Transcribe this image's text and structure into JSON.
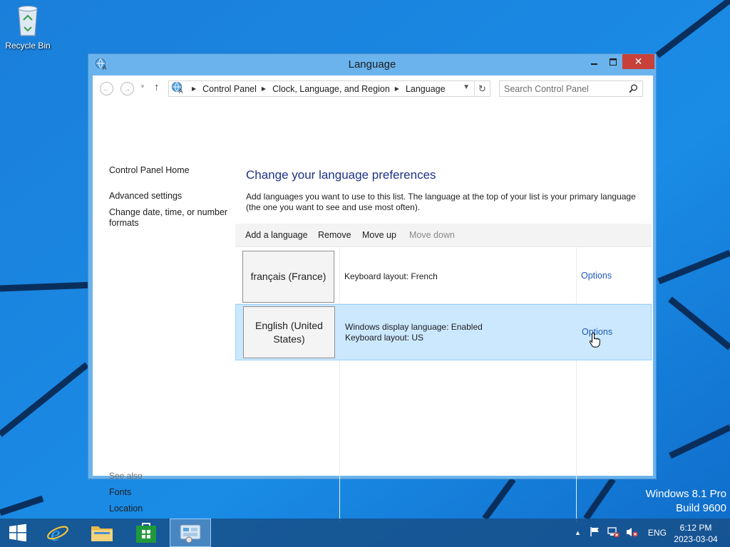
{
  "desktop": {
    "recycle_bin_label": "Recycle Bin",
    "watermark_line1": "Windows 8.1 Pro",
    "watermark_line2": "Build 9600"
  },
  "window": {
    "title": "Language",
    "close_glyph": "✕"
  },
  "address_bar": {
    "breadcrumbs": [
      "Control Panel",
      "Clock, Language, and Region",
      "Language"
    ],
    "search_placeholder": "Search Control Panel"
  },
  "left_pane": {
    "links": [
      "Control Panel Home",
      "Advanced settings",
      "Change date, time, or number formats"
    ],
    "see_also_heading": "See also",
    "see_also_links": [
      "Fonts",
      "Location"
    ]
  },
  "main": {
    "title": "Change your language preferences",
    "description": "Add languages you want to use to this list. The language at the top of your list is your primary language (the one you want to see and use most often).",
    "toolbar": {
      "add": "Add a language",
      "remove": "Remove",
      "move_up": "Move up",
      "move_down": "Move down"
    },
    "languages": [
      {
        "name": "français (France)",
        "info_line1": "Keyboard layout: French",
        "info_line2": "",
        "options": "Options",
        "selected": false
      },
      {
        "name": "English (United States)",
        "info_line1": "Windows display language: Enabled",
        "info_line2": "Keyboard layout: US",
        "options": "Options",
        "selected": true
      }
    ]
  },
  "taskbar": {
    "input_indicator": "ENG",
    "time": "6:12 PM",
    "date": "2023-03-04"
  },
  "colors": {
    "accent_blue": "#1b86df",
    "link_blue": "#1f58b7",
    "title_blue": "#1e3287",
    "selection": "#cce8ff",
    "close_red": "#c7403a"
  }
}
